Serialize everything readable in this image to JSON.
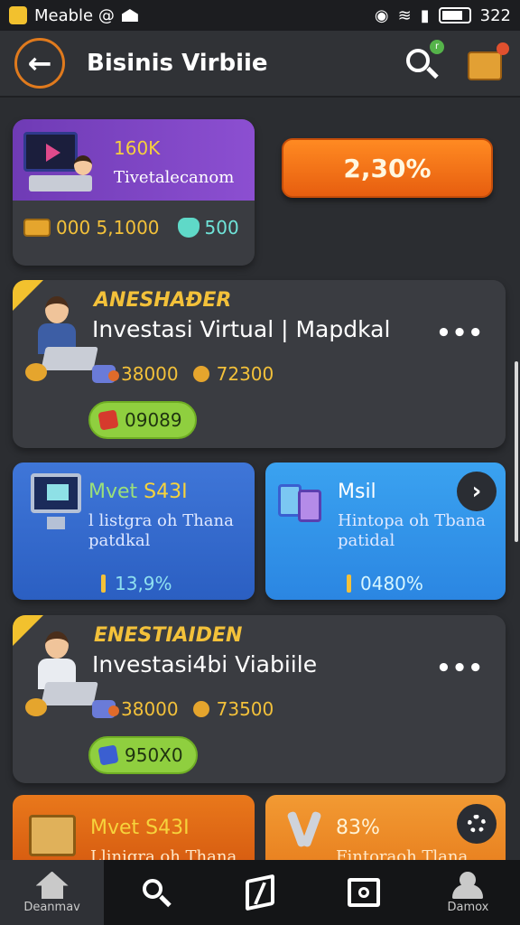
{
  "status_bar": {
    "app_name": "Meable @",
    "time": "322"
  },
  "header": {
    "title": "Bisinis Virbiie"
  },
  "summary_card": {
    "amount": "160K",
    "subtitle": "Tivetalecanom",
    "coins": "000 5,1000",
    "gems": "500"
  },
  "percent_button": {
    "label": "2,30%"
  },
  "investments": [
    {
      "label": "ANESHAÐER",
      "name": "Investasi Virtual | Mapdkal",
      "stat1": "38000",
      "stat2": "72300",
      "pill": "09089"
    },
    {
      "label": "ENESTIAIDEN",
      "name": "Investasi4bi Viabiile",
      "stat1": "38000",
      "stat2": "73500",
      "pill": "950X0"
    }
  ],
  "tiles": [
    {
      "title": "Mvet S43I",
      "sub1": "l listgra oh Thana",
      "sub2": "patdkal",
      "value": "13,9%"
    },
    {
      "title": "Msil",
      "sub1": "Hintopa oh Tbana",
      "sub2": "patidal",
      "value": "0480%"
    }
  ],
  "orange_tiles": [
    {
      "title": "Mvet S43I",
      "sub": "Llinigra oh Thana"
    },
    {
      "title": "83%",
      "sub": "Fintoraoh Tlana"
    }
  ],
  "bottom_nav": [
    {
      "label": "Deanmav"
    },
    {
      "label": ""
    },
    {
      "label": ""
    },
    {
      "label": ""
    },
    {
      "label": "Damox"
    }
  ],
  "colors": {
    "background": "#2b2d31",
    "card": "#3a3c41",
    "accent_orange": "#f07a1c",
    "gold": "#f3c13a",
    "purple": "#7a42c2",
    "blue_tile": "#3a7ee0",
    "green_pill": "#8fcf3f"
  },
  "icons": {
    "back": "arrow-left-icon",
    "search": "search-icon",
    "chest": "treasure-box-icon",
    "more": "more-dots-icon",
    "chevron": "chevron-right-icon",
    "gear": "gear-icon"
  }
}
